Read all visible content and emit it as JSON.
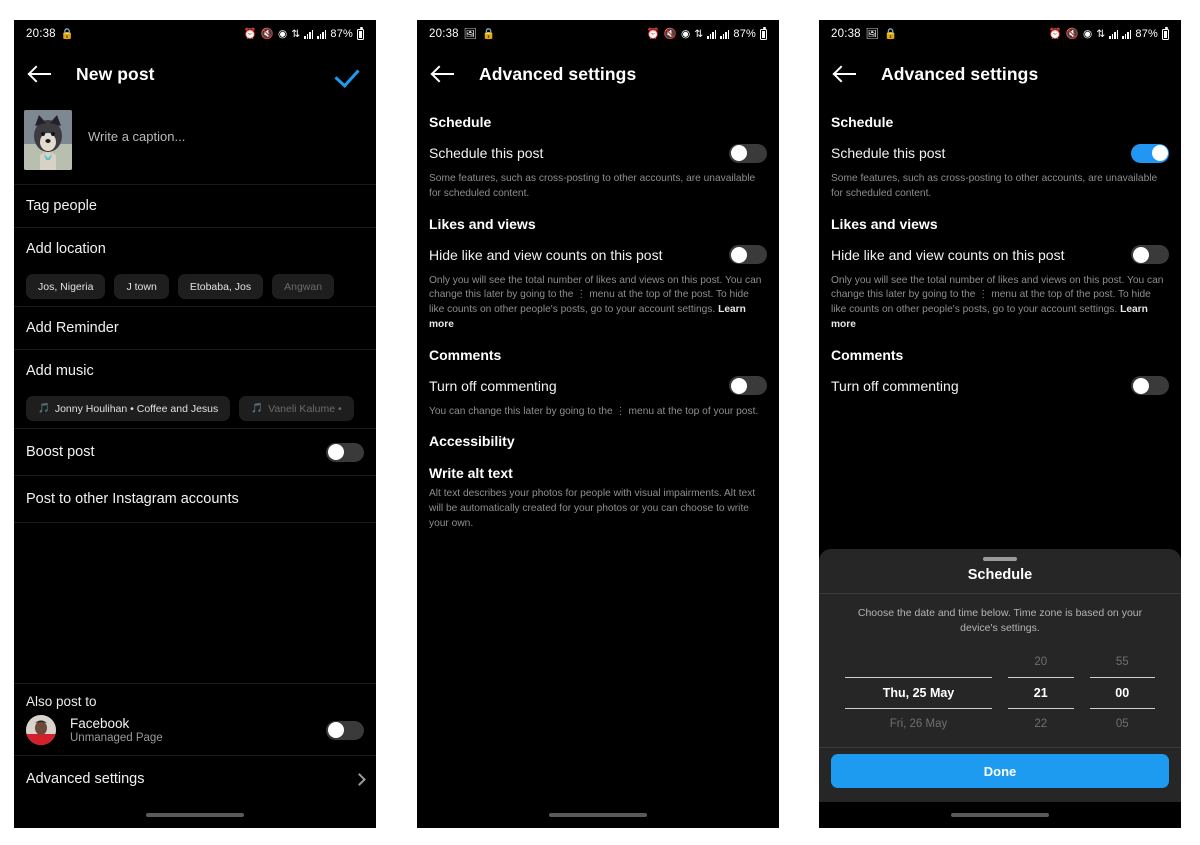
{
  "status_bar": {
    "time": "20:38",
    "battery": "87%",
    "left_icons": [
      "lock-icon",
      "image-icon"
    ],
    "right_icons": [
      "alarm-icon",
      "mute-icon",
      "vpn-icon",
      "wifi-icon",
      "signal-icon",
      "signal2-icon",
      "battery-icon"
    ]
  },
  "panel1": {
    "title": "New post",
    "back_icon": "back-arrow-icon",
    "confirm_icon": "checkmark-icon",
    "caption_placeholder": "Write a caption...",
    "rows": [
      {
        "label": "Tag people"
      },
      {
        "label": "Add location"
      }
    ],
    "location_chips": [
      "Jos, Nigeria",
      "J town",
      "Etobaba, Jos",
      "Angwan"
    ],
    "reminder_label": "Add Reminder",
    "music_label": "Add music",
    "music_chips": [
      {
        "icon": "music-note-icon",
        "label": "Jonny Houlihan • Coffee and Jesus"
      },
      {
        "icon": "music-note-icon",
        "label": "Vaneli Kalume •"
      }
    ],
    "boost_post": {
      "label": "Boost post",
      "state": "off"
    },
    "post_other_accounts": "Post to other Instagram accounts",
    "also_post_to": "Also post to",
    "facebook": {
      "name": "Facebook",
      "sub": "Unmanaged Page",
      "state": "off"
    },
    "advanced_settings": "Advanced settings",
    "chevron_icon": "chevron-right-icon"
  },
  "panel2": {
    "title": "Advanced settings",
    "back_icon": "back-arrow-icon",
    "schedule_heading": "Schedule",
    "schedule_toggle": {
      "label": "Schedule this post",
      "state": "off"
    },
    "schedule_desc": "Some features, such as cross-posting to other accounts, are unavailable for scheduled content.",
    "likes_heading": "Likes and views",
    "hide_toggle": {
      "label": "Hide like and view counts on this post",
      "state": "off"
    },
    "hide_desc": "Only you will see the total number of likes and views on this post. You can change this later by going to the ⋮ menu at the top of the post. To hide like counts on other people's posts, go to your account settings.",
    "learn_more": "Learn more",
    "comments_heading": "Comments",
    "comment_toggle": {
      "label": "Turn off commenting",
      "state": "off"
    },
    "comment_desc": "You can change this later by going to the ⋮ menu at the top of your post.",
    "accessibility_heading": "Accessibility",
    "alt_text_heading": "Write alt text",
    "alt_text_desc": "Alt text describes your photos for people with visual impairments. Alt text will be automatically created for your photos or you can choose to write your own."
  },
  "panel3": {
    "title": "Advanced settings",
    "back_icon": "back-arrow-icon",
    "schedule_heading": "Schedule",
    "schedule_toggle": {
      "label": "Schedule this post",
      "state": "on"
    },
    "schedule_desc": "Some features, such as cross-posting to other accounts, are unavailable for scheduled content.",
    "likes_heading": "Likes and views",
    "hide_toggle": {
      "label": "Hide like and view counts on this post",
      "state": "off"
    },
    "hide_desc": "Only you will see the total number of likes and views on this post. You can change this later by going to the ⋮ menu at the top of the post. To hide like counts on other people's posts, go to your account settings.",
    "learn_more": "Learn more",
    "comments_heading": "Comments",
    "comment_toggle": {
      "label": "Turn off commenting",
      "state": "off"
    },
    "sheet": {
      "grabber_icon": "drag-handle-icon",
      "title": "Schedule",
      "description": "Choose the date and time below. Time zone is based on your device's settings.",
      "picker": {
        "date": {
          "above": "",
          "selected": "Thu, 25 May",
          "below": "Fri, 26 May"
        },
        "hour": {
          "above": "20",
          "selected": "21",
          "below": "22"
        },
        "minute": {
          "above": "55",
          "selected": "00",
          "below": "05"
        }
      },
      "done_label": "Done"
    }
  },
  "colors": {
    "accent_blue": "#1d9bf0",
    "toggle_on": "#2196f3",
    "background": "#000000",
    "sheet_bg": "#262626"
  }
}
